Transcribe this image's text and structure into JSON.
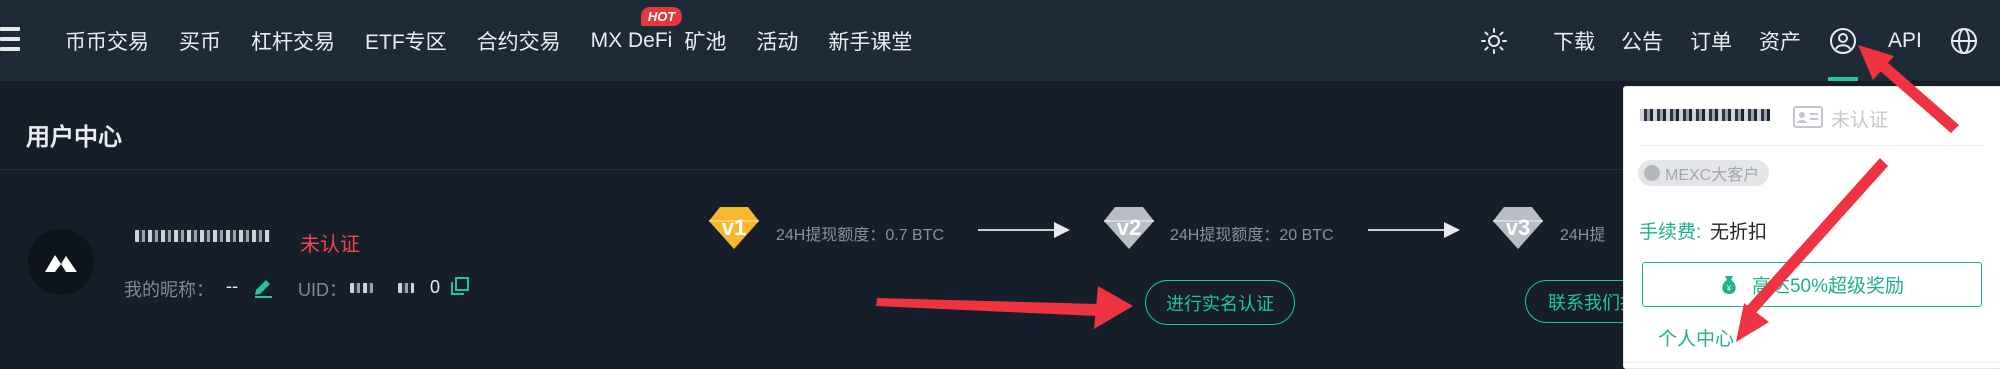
{
  "nav": {
    "items": [
      {
        "label": "币币交易"
      },
      {
        "label": "买币"
      },
      {
        "label": "杠杆交易"
      },
      {
        "label": "ETF专区"
      },
      {
        "label": "合约交易"
      },
      {
        "label": "MX DeFi",
        "badge": "HOT"
      },
      {
        "label": "矿池"
      },
      {
        "label": "活动"
      },
      {
        "label": "新手课堂"
      }
    ],
    "right": {
      "theme_icon": "sun-icon",
      "download": "下载",
      "announcement": "公告",
      "orders": "订单",
      "assets": "资产",
      "user_icon": "user-circle-icon",
      "api": "API",
      "language_icon": "globe-icon"
    }
  },
  "page": {
    "title": "用户中心"
  },
  "profile": {
    "verify_status": "未认证",
    "nickname_label": "我的昵称：",
    "nickname_value": "--",
    "uid_label": "UID：",
    "uid_tail": "0"
  },
  "levels": [
    {
      "badge": "v1",
      "quota": "24H提现额度：0.7 BTC",
      "color": "#f5b82e"
    },
    {
      "badge": "v2",
      "quota": "24H提现额度：20 BTC",
      "color": "#b9bec6"
    },
    {
      "badge": "v3",
      "quota": "24H提",
      "color": "#b9bec6"
    }
  ],
  "buttons": {
    "verify": "进行实名认证",
    "contact": "联系我们提"
  },
  "dropdown": {
    "verify_status": "未认证",
    "vip_badge": "MEXC大客户",
    "fee_label": "手续费:",
    "fee_value": "无折扣",
    "reward_text": "高达50%超级奖励",
    "personal_center": "个人中心"
  },
  "colors": {
    "accent": "#1fc7a0",
    "nav_bg": "#1f2a38",
    "page_bg": "#151e29",
    "warning_red": "#f0444f",
    "annotation_arrow": "#ef3340",
    "v1_gold": "#f5b82e"
  }
}
